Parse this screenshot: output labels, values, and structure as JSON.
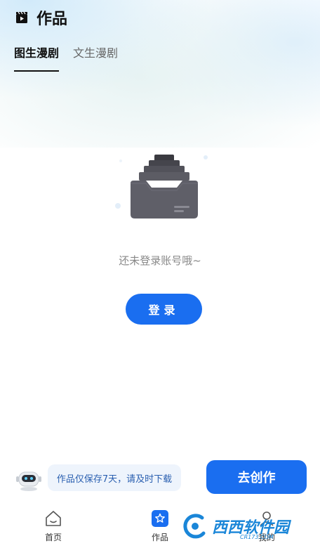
{
  "header": {
    "title": "作品",
    "icon": "clapperboard-icon"
  },
  "tabs": [
    {
      "label": "图生漫剧",
      "active": true
    },
    {
      "label": "文生漫剧",
      "active": false
    }
  ],
  "empty_state": {
    "message": "还未登录账号哦~",
    "icon": "inbox-tray-icon"
  },
  "login_button": {
    "label": "登录"
  },
  "tip": {
    "text": "作品仅保存7天，请及时下载"
  },
  "create_button": {
    "label": "去创作"
  },
  "bottom_nav": [
    {
      "label": "首页",
      "icon": "home-icon",
      "active": false
    },
    {
      "label": "作品",
      "icon": "star-icon",
      "active": true
    },
    {
      "label": "我的",
      "icon": "profile-icon",
      "active": false
    }
  ],
  "watermark": {
    "text": "西西软件园",
    "sub": "CR173.COM"
  },
  "colors": {
    "accent": "#1a6ef0",
    "tip_bg": "#eef4fc",
    "tip_text": "#2a5fb0"
  }
}
